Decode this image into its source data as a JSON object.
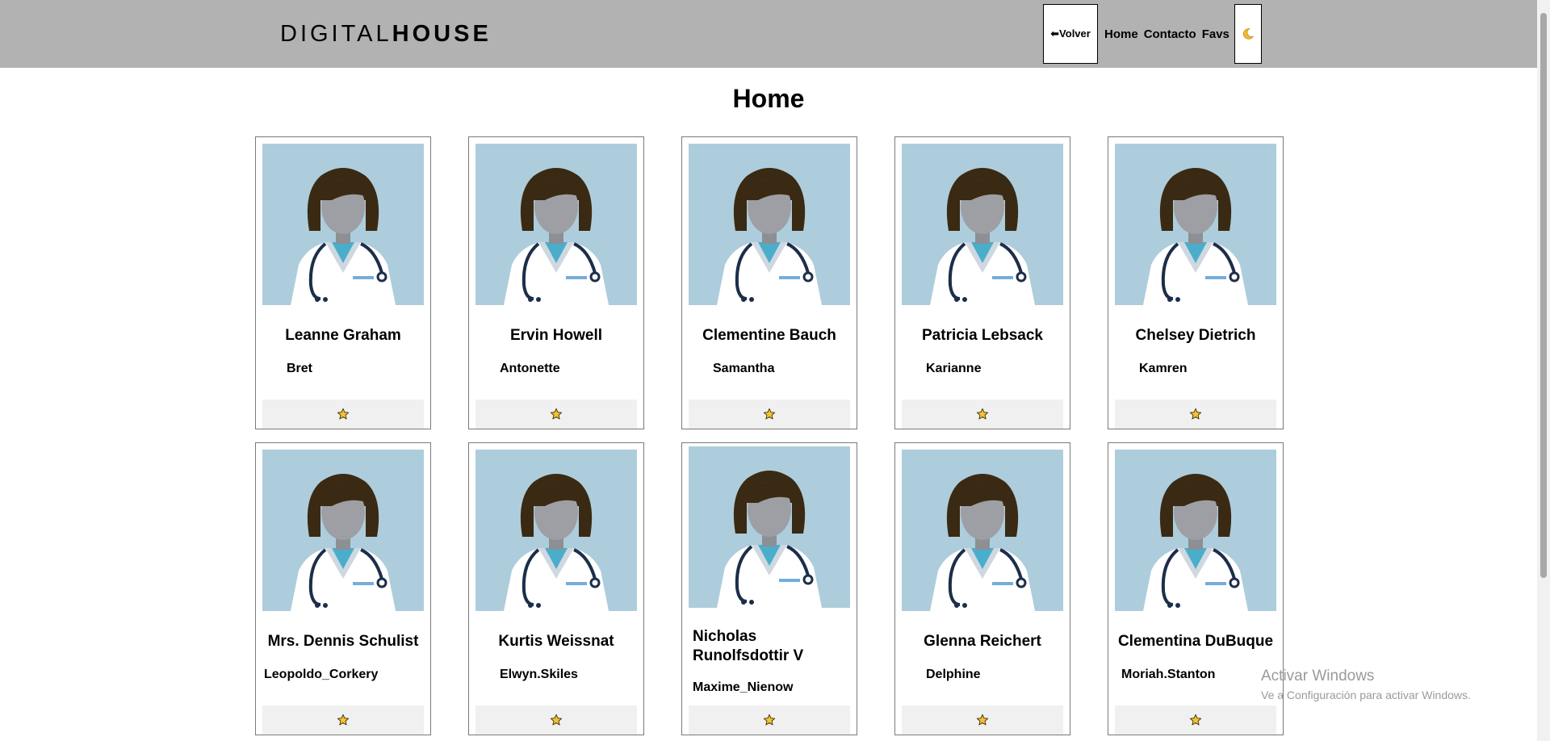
{
  "header": {
    "logo_light": "DIGITAL",
    "logo_bold": "HOUSE",
    "back_label": "⬅Volver",
    "nav": [
      "Home",
      "Contacto",
      "Favs"
    ],
    "theme_icon": "moon-icon"
  },
  "page": {
    "title": "Home"
  },
  "cards": [
    {
      "name": "Leanne Graham",
      "username": "Bret"
    },
    {
      "name": "Ervin Howell",
      "username": "Antonette"
    },
    {
      "name": "Clementine Bauch",
      "username": "Samantha"
    },
    {
      "name": "Patricia Lebsack",
      "username": "Karianne"
    },
    {
      "name": "Chelsey Dietrich",
      "username": "Kamren"
    },
    {
      "name": "Mrs. Dennis Schulist",
      "username": "Leopoldo_Corkery"
    },
    {
      "name": "Kurtis Weissnat",
      "username": "Elwyn.Skiles"
    },
    {
      "name": "Nicholas Runolfsdottir V",
      "username": "Maxime_Nienow"
    },
    {
      "name": "Glenna Reichert",
      "username": "Delphine"
    },
    {
      "name": "Clementina DuBuque",
      "username": "Moriah.Stanton"
    }
  ],
  "card_icons": {
    "avatar": "doctor-avatar-icon",
    "favorite": "star-icon"
  },
  "watermark": {
    "line1": "Activar Windows",
    "line2": "Ve a Configuración para activar Windows."
  },
  "colors": {
    "navbar": "#b2b2b2",
    "avatar_bg": "#aecddc",
    "star": "#f2c230",
    "fav_bar": "#f0f0f0"
  }
}
